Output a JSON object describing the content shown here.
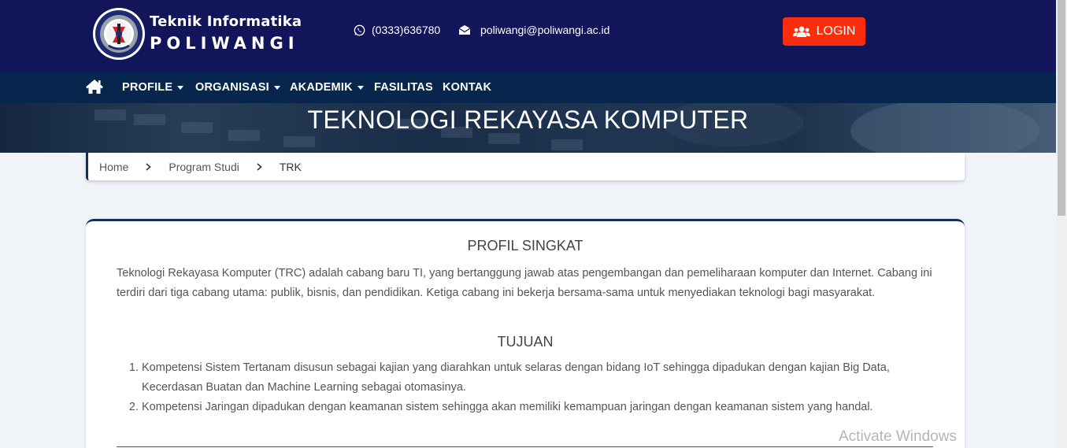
{
  "header": {
    "brand_line1": "Teknik Informatika",
    "brand_line2": "POLIWANGI",
    "phone": "(0333)636780",
    "email": "poliwangi@poliwangi.ac.id",
    "login_label": "LOGIN"
  },
  "nav": {
    "items": [
      {
        "label": "PROFILE",
        "dropdown": true
      },
      {
        "label": "ORGANISASI",
        "dropdown": true
      },
      {
        "label": "AKADEMIK",
        "dropdown": true
      },
      {
        "label": "FASILITAS",
        "dropdown": false
      },
      {
        "label": "KONTAK",
        "dropdown": false
      }
    ]
  },
  "hero": {
    "title": "TEKNOLOGI REKAYASA KOMPUTER"
  },
  "breadcrumb": {
    "items": [
      "Home",
      "Program Studi",
      "TRK"
    ]
  },
  "content": {
    "profil_title": "PROFIL SINGKAT",
    "profil_text": "Teknologi Rekayasa Komputer (TRC) adalah cabang baru TI, yang bertanggung jawab atas pengembangan dan pemeliharaan komputer dan Internet. Cabang ini terdiri dari tiga cabang utama: publik, bisnis, dan pendidikan. Ketiga cabang ini bekerja bersama-sama untuk menyediakan teknologi bagi masyarakat.",
    "tujuan_title": "TUJUAN",
    "tujuan_items": [
      {
        "num": "1.",
        "text": "Kompetensi Sistem Tertanam disusun sebagai kajian yang diarahkan untuk selaras dengan bidang IoT sehingga dipadukan dengan kajian Big Data, Kecerdasan Buatan dan Machine Learning sebagai otomasinya."
      },
      {
        "num": "2.",
        "text": "Kompetensi Jaringan dipadukan dengan keamanan sistem sehingga akan memiliki kemampuan jaringan dengan keamanan sistem yang handal."
      }
    ]
  },
  "watermark": "Activate Windows",
  "colors": {
    "header_bg": "#12155a",
    "nav_bg": "#08264d",
    "login_bg": "#fa2d0f",
    "page_bg": "#f0f4f8"
  },
  "icons": [
    "logo-seal-icon",
    "whatsapp-icon",
    "envelope-icon",
    "users-icon",
    "home-icon",
    "chevron-right-icon",
    "caret-down-icon"
  ]
}
